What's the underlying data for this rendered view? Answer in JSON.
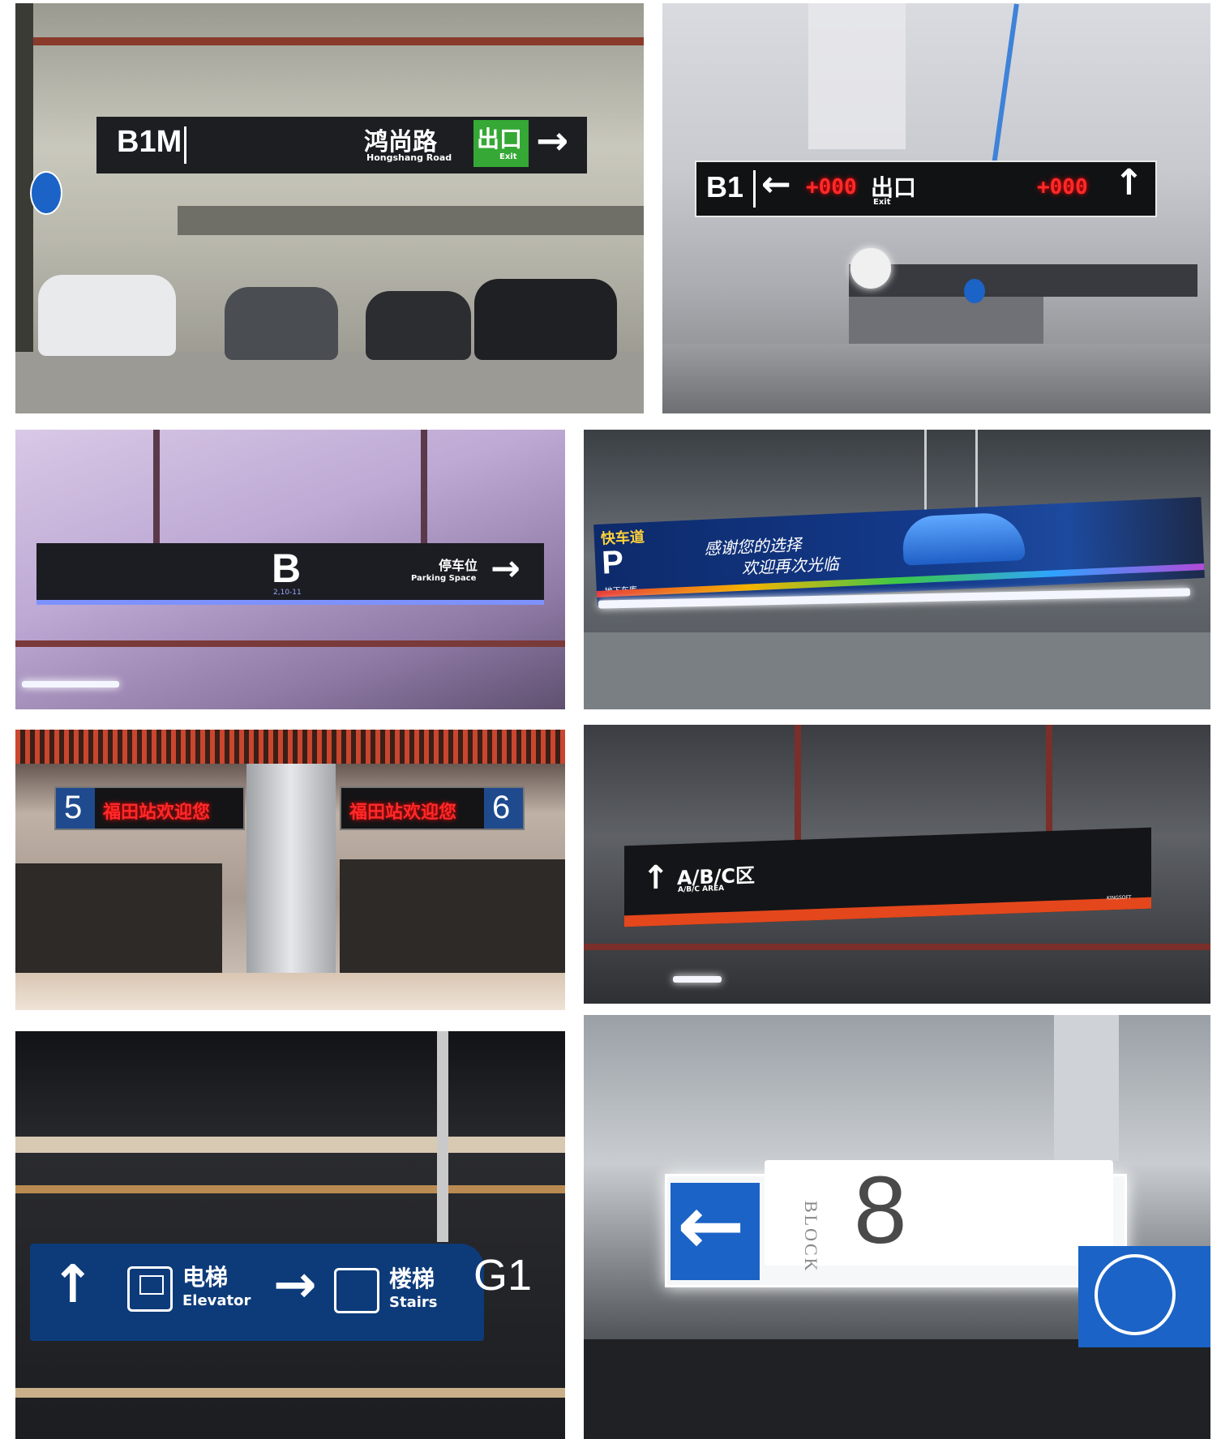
{
  "photos": {
    "p1": {
      "level": "B1M",
      "cn_road": "鸿尚路",
      "cn_exit": "出口",
      "exit_en": "Exit",
      "road_en": "Hongshang Road",
      "arrow": "→",
      "plates": [
        "",
        "",
        "",
        ""
      ]
    },
    "p2": {
      "level": "B1",
      "arrow_left": "←",
      "led_left": "+000",
      "cn_exit": "出口",
      "exit_en": "Exit",
      "led_right": "+000",
      "arrow_up": "↑"
    },
    "p3": {
      "letter": "B",
      "sub": "2,10-11",
      "cn": "停车位",
      "en": "Parking Space",
      "arrow": "→"
    },
    "p4": {
      "tag": "快车道",
      "line1": "感谢您的选择",
      "line2": "欢迎再次光临",
      "p": "P",
      "sub": "地下车库"
    },
    "p5": {
      "left_num": "5",
      "left_led": "福田站欢迎您",
      "right_led": "福田站欢迎您",
      "right_num": "6"
    },
    "p6": {
      "arrow": "↑",
      "zone": "A/B/C区",
      "zone_en": "A/B/C AREA",
      "brand": "KINGSOFT"
    },
    "p7": {
      "arrow_up": "↑",
      "elevator_cn": "电梯",
      "elevator_en": "Elevator",
      "arrow_right": "→",
      "stairs_cn": "楼梯",
      "stairs_en": "Stairs",
      "level": "G1"
    },
    "p8": {
      "block": "BLOCK",
      "number": "8",
      "arrow": "←"
    }
  },
  "colors": {
    "sign_dark": "#1c1e22",
    "exit_green": "#35a835",
    "sign_blue": "#0d3b7a",
    "led_red": "#ff2a2a",
    "road_blue": "#1b63c6"
  }
}
